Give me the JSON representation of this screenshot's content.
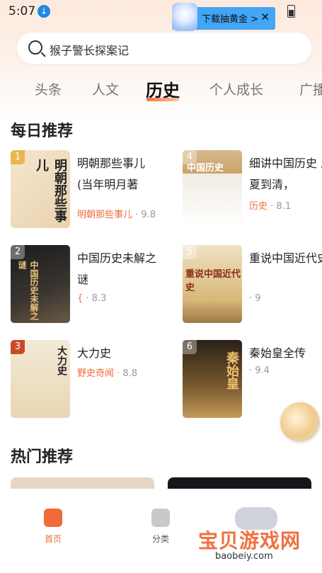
{
  "status_bar": {
    "time": "5:07"
  },
  "ad": {
    "label": "下载抽黄金 >",
    "close": "✕"
  },
  "search": {
    "placeholder": "猴子警长探案记"
  },
  "tabs": [
    {
      "label": "头条"
    },
    {
      "label": "人文"
    },
    {
      "label": "历史",
      "active": true
    },
    {
      "label": "个人成长"
    },
    {
      "label": "广播"
    }
  ],
  "daily": {
    "title": "每日推荐",
    "books": [
      {
        "rank": "1",
        "cover_text": "明朝那些事儿",
        "title": "明朝那些事儿(当年明月著",
        "category": "明朝那些事儿",
        "score": "· 9.8"
      },
      {
        "rank": "4",
        "cover_text": "中国历史",
        "title": "细讲中国历史 从夏到清，",
        "category": "历史",
        "score": "· 8.1"
      },
      {
        "rank": "2",
        "cover_text": "中国历史未解之谜",
        "title": "中国历史未解之谜",
        "category": "{",
        "score": "· 8.3"
      },
      {
        "rank": "5",
        "cover_text": "重说中国近代史",
        "title": "重说中国近代史",
        "category": "",
        "score": "· 9"
      },
      {
        "rank": "3",
        "cover_text": "大力史",
        "title": "大力史",
        "category": "野史奇闻",
        "score": "· 8.8"
      },
      {
        "rank": "6",
        "cover_text": "秦始皇",
        "title": "秦始皇全传",
        "category": "",
        "score": "· 9.4"
      }
    ]
  },
  "hot": {
    "title": "热门推荐"
  },
  "bottom_nav": [
    {
      "label": "首页",
      "active": true
    },
    {
      "label": "分类"
    }
  ],
  "watermark": {
    "text": "宝贝游戏网",
    "url": "baobeiy.com"
  },
  "colors": {
    "accent": "#ef6b3a",
    "rank_gold": "#e8b84a"
  }
}
